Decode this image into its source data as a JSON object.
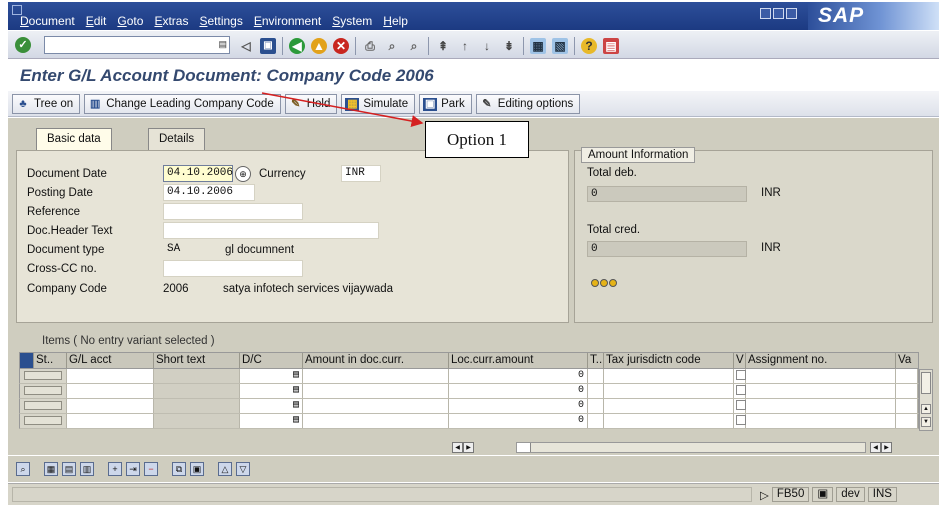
{
  "menubar": {
    "items": [
      "Document",
      "Edit",
      "Goto",
      "Extras",
      "Settings",
      "Environment",
      "System",
      "Help"
    ],
    "logo": "SAP",
    "brand_color": "#2d4f9a"
  },
  "stdbar": {
    "command_value": "",
    "icons": [
      "enter-icon",
      "save-icon",
      "back-icon",
      "exit-icon",
      "cancel-icon",
      "print-icon",
      "find-icon",
      "find-next-icon",
      "first-page-icon",
      "prev-page-icon",
      "next-page-icon",
      "last-page-icon",
      "new-session-icon",
      "shortcut-icon",
      "help-icon",
      "layout-icon"
    ]
  },
  "title": "Enter G/L Account Document: Company Code 2006",
  "app_toolbar": {
    "tree_on": "Tree on",
    "change_leading": "Change Leading Company Code",
    "hold": "Hold",
    "simulate": "Simulate",
    "park": "Park",
    "editing_options": "Editing options"
  },
  "callout": "Option 1",
  "tabs": {
    "basic": "Basic data",
    "details": "Details"
  },
  "form": {
    "document_date_label": "Document Date",
    "document_date": "04.10.2006",
    "currency_label": "Currency",
    "currency": "INR",
    "posting_date_label": "Posting Date",
    "posting_date": "04.10.2006",
    "reference_label": "Reference",
    "reference": "",
    "header_text_label": "Doc.Header Text",
    "header_text": "",
    "doc_type_label": "Document type",
    "doc_type": "SA",
    "doc_type_desc": "gl documnent",
    "cross_cc_label": "Cross-CC no.",
    "cross_cc": "",
    "company_code_label": "Company Code",
    "company_code": "2006",
    "company_name": "satya infotech services vijaywada"
  },
  "amounts": {
    "section": "Amount Information",
    "total_deb_label": "Total deb.",
    "total_deb": "0",
    "total_deb_cur": "INR",
    "total_cred_label": "Total cred.",
    "total_cred": "0",
    "total_cred_cur": "INR",
    "status_light": "yellow"
  },
  "items": {
    "caption": "Items ( No entry variant selected )",
    "headers": [
      "St..",
      "G/L acct",
      "Short text",
      "D/C",
      "Amount in doc.curr.",
      "Loc.curr.amount",
      "T..",
      "Tax jurisdictn code",
      "V",
      "Assignment no.",
      "Va"
    ],
    "rows": [
      {
        "loc_amount": "0"
      },
      {
        "loc_amount": "0"
      },
      {
        "loc_amount": "0"
      },
      {
        "loc_amount": "0"
      }
    ]
  },
  "status": {
    "message": "",
    "transaction": "FB50",
    "system": "dev",
    "mode": "INS"
  }
}
